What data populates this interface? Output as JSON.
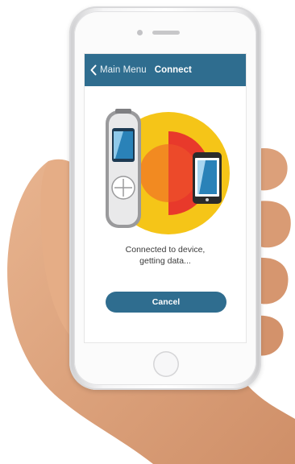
{
  "navbar": {
    "back_label": "Main Menu",
    "title": "Connect",
    "color": "#2f6d8f"
  },
  "icons": {
    "back": "chevron-left-icon",
    "device": "glucose-meter-icon",
    "phone": "smartphone-icon"
  },
  "status": {
    "line1": "Connected to device,",
    "line2": "getting data..."
  },
  "actions": {
    "cancel_label": "Cancel"
  },
  "colors": {
    "accent": "#2f6d8f",
    "signal_outer": "#f5c518",
    "signal_inner": "#e8392b"
  }
}
